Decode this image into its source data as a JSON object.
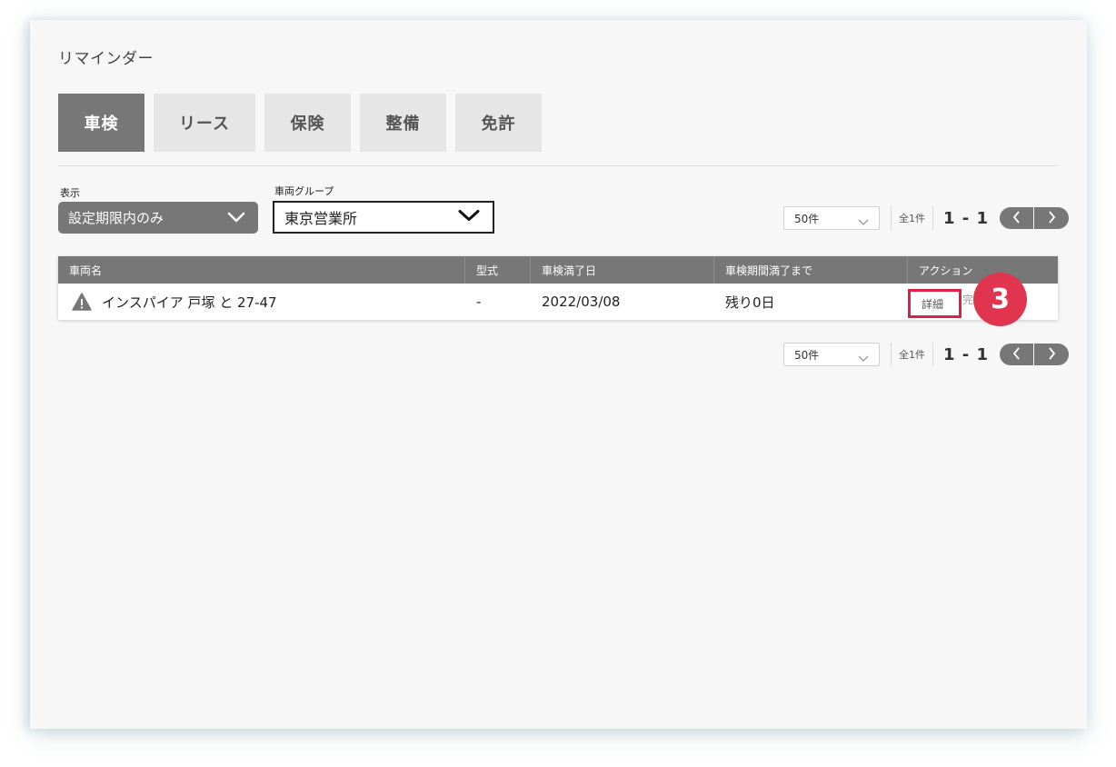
{
  "page": {
    "title": "リマインダー"
  },
  "tabs": [
    {
      "label": "車検",
      "active": true
    },
    {
      "label": "リース",
      "active": false
    },
    {
      "label": "保険",
      "active": false
    },
    {
      "label": "整備",
      "active": false
    },
    {
      "label": "免許",
      "active": false
    }
  ],
  "filters": {
    "display_label": "表示",
    "display_value": "設定期限内のみ",
    "group_label": "車両グループ",
    "group_value": "東京営業所"
  },
  "pagination": {
    "per_page": "50件",
    "total": "全1件",
    "range": "1 - 1"
  },
  "table": {
    "headers": [
      "車両名",
      "型式",
      "車検満了日",
      "車検期間満了まで",
      "アクション"
    ],
    "rows": [
      {
        "vehicle_name": "インスパイア 戸塚 と 27-47",
        "model": "-",
        "expiry_date": "2022/03/08",
        "remaining": "残り0日",
        "action_detail": "詳細",
        "action_other": "完"
      }
    ]
  },
  "annotation": {
    "step_number": "3"
  },
  "colors": {
    "tab_active": "#777777",
    "tab_inactive": "#e6e6e6",
    "highlight": "#e01e47",
    "badge": "#e0344f"
  },
  "icons": [
    "warning-icon",
    "chevron-down-icon",
    "chevron-left-icon",
    "chevron-right-icon"
  ]
}
